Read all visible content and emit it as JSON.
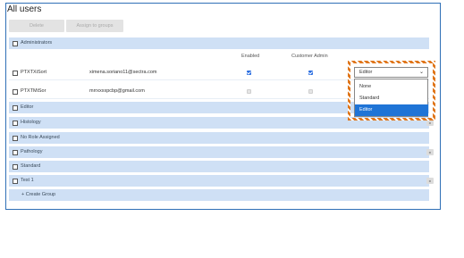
{
  "title": "All users",
  "toolbar": {
    "delete_label": "Delete",
    "assign_label": "Assign to groups"
  },
  "groups": [
    {
      "label": "Administrators"
    },
    {
      "label": "Editor"
    },
    {
      "label": "Histology"
    },
    {
      "label": "No Role Assigned"
    },
    {
      "label": "Pathology"
    },
    {
      "label": "Standard"
    },
    {
      "label": "Test 1"
    }
  ],
  "create_group_label": "+ Create Group",
  "columns": {
    "enabled": "Enabled",
    "customer_admin": "Customer Admin"
  },
  "users": [
    {
      "name": "PTXTXiSort",
      "email": "ximena.soriano11@sectra.com",
      "enabled": true,
      "customer_admin": true,
      "role": "Editor"
    },
    {
      "name": "PTXTMiSor",
      "email": "mrrxxxxpcbp@gmail.com",
      "enabled": false,
      "customer_admin": false,
      "role": ""
    }
  ],
  "role_dropdown": {
    "selected": "Editor",
    "options": [
      "None",
      "Standard",
      "Editor"
    ],
    "highlighted_index": 2
  },
  "icons": {
    "lock": "lock-icon",
    "chevron": "chevron-down-icon"
  },
  "colors": {
    "accent": "#1f74d6",
    "group_bg": "#cfe0f5",
    "highlight": "#e0761b"
  }
}
